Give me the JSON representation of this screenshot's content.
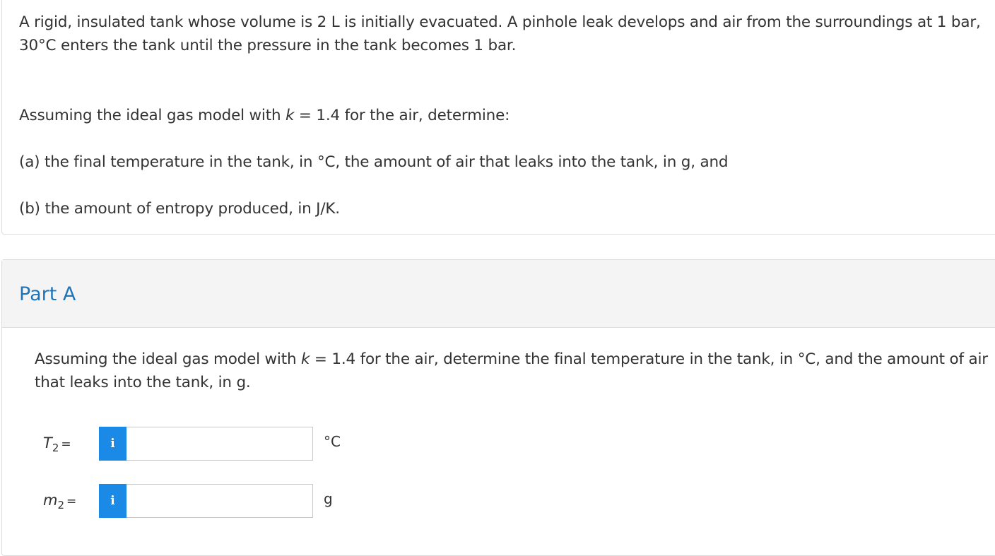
{
  "problem": {
    "intro": "A rigid, insulated tank whose volume is 2 L is initially evacuated. A pinhole leak develops and air from the surroundings at 1 bar, 30°C enters the tank until the pressure in the tank becomes 1 bar.",
    "assume_before_k": "Assuming the ideal gas model with ",
    "k_symbol": "k",
    "assume_after_k": " = 1.4 for the air, determine:",
    "part_a": "(a) the final temperature in the tank, in °C, the amount of air that leaks into the tank, in g, and",
    "part_b": "(b) the amount of entropy produced, in J/K."
  },
  "part": {
    "title": "Part A",
    "question_before_k": "Assuming the ideal gas model with ",
    "k_symbol": "k",
    "question_after_k": " = 1.4 for the air, determine the final temperature in the tank, in °C, and the amount of air that leaks into the tank, in g.",
    "answers": [
      {
        "var": "T",
        "sub": "2",
        "eq": "=",
        "info": "i",
        "value": "",
        "unit": "°C"
      },
      {
        "var": "m",
        "sub": "2",
        "eq": "=",
        "info": "i",
        "value": "",
        "unit": "g"
      }
    ]
  },
  "colors": {
    "title_blue": "#1f75b8",
    "info_blue": "#1a8ae6",
    "header_bg": "#f4f4f4"
  }
}
